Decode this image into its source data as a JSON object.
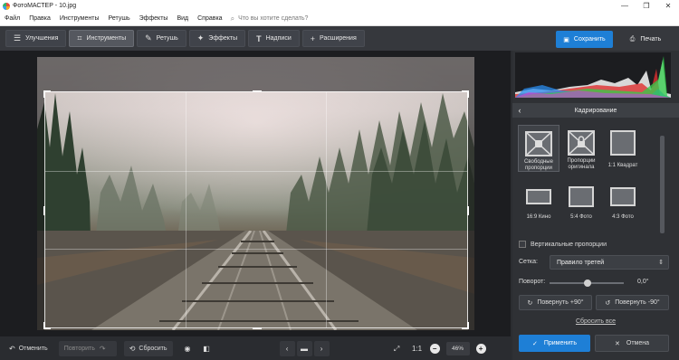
{
  "window": {
    "title": "ФотоМАСТЕР - 10.jpg",
    "minimize": "—",
    "maximize": "❐",
    "close": "✕"
  },
  "menu": {
    "items": [
      "Файл",
      "Правка",
      "Инструменты",
      "Ретушь",
      "Эффекты",
      "Вид",
      "Справка"
    ],
    "search_placeholder": "Что вы хотите сделать?"
  },
  "toolbar": {
    "tabs": [
      {
        "label": "Улучшения",
        "icon": "sliders-icon"
      },
      {
        "label": "Инструменты",
        "icon": "crop-icon",
        "active": true
      },
      {
        "label": "Ретушь",
        "icon": "brush-icon"
      },
      {
        "label": "Эффекты",
        "icon": "magic-wand-icon"
      },
      {
        "label": "Надписи",
        "icon": "text-icon"
      },
      {
        "label": "Расширения",
        "icon": "plus-icon"
      }
    ],
    "save_label": "Сохранить",
    "print_label": "Печать"
  },
  "bottombar": {
    "undo_label": "Отменить",
    "redo_label": "Повторить",
    "reset_label": "Сбросить",
    "ratio_label": "1:1",
    "zoom_value": "46%"
  },
  "panel": {
    "title": "Кадрирование",
    "presets": [
      {
        "label": "Свободные пропорции",
        "selected": true
      },
      {
        "label": "Пропорции оригинала"
      },
      {
        "label": "1:1 Квадрат"
      },
      {
        "label": "16:9 Кино"
      },
      {
        "label": "5:4 Фото"
      },
      {
        "label": "4:3 Фото"
      }
    ],
    "vertical_label": "Вертикальные пропорции",
    "grid_label": "Сетка:",
    "grid_value": "Правило третей",
    "rotation_label": "Поворот:",
    "rotation_value": "0,0°",
    "rotation_level": 0.5,
    "rotate_plus_label": "Повернуть +90°",
    "rotate_minus_label": "Повернуть -90°",
    "reset_all_label": "Сбросить все",
    "apply_label": "Применить",
    "cancel_label": "Отмена"
  },
  "colors": {
    "accent": "#1e7fd6",
    "background": "#2b2d31",
    "panel": "#2f3135"
  }
}
